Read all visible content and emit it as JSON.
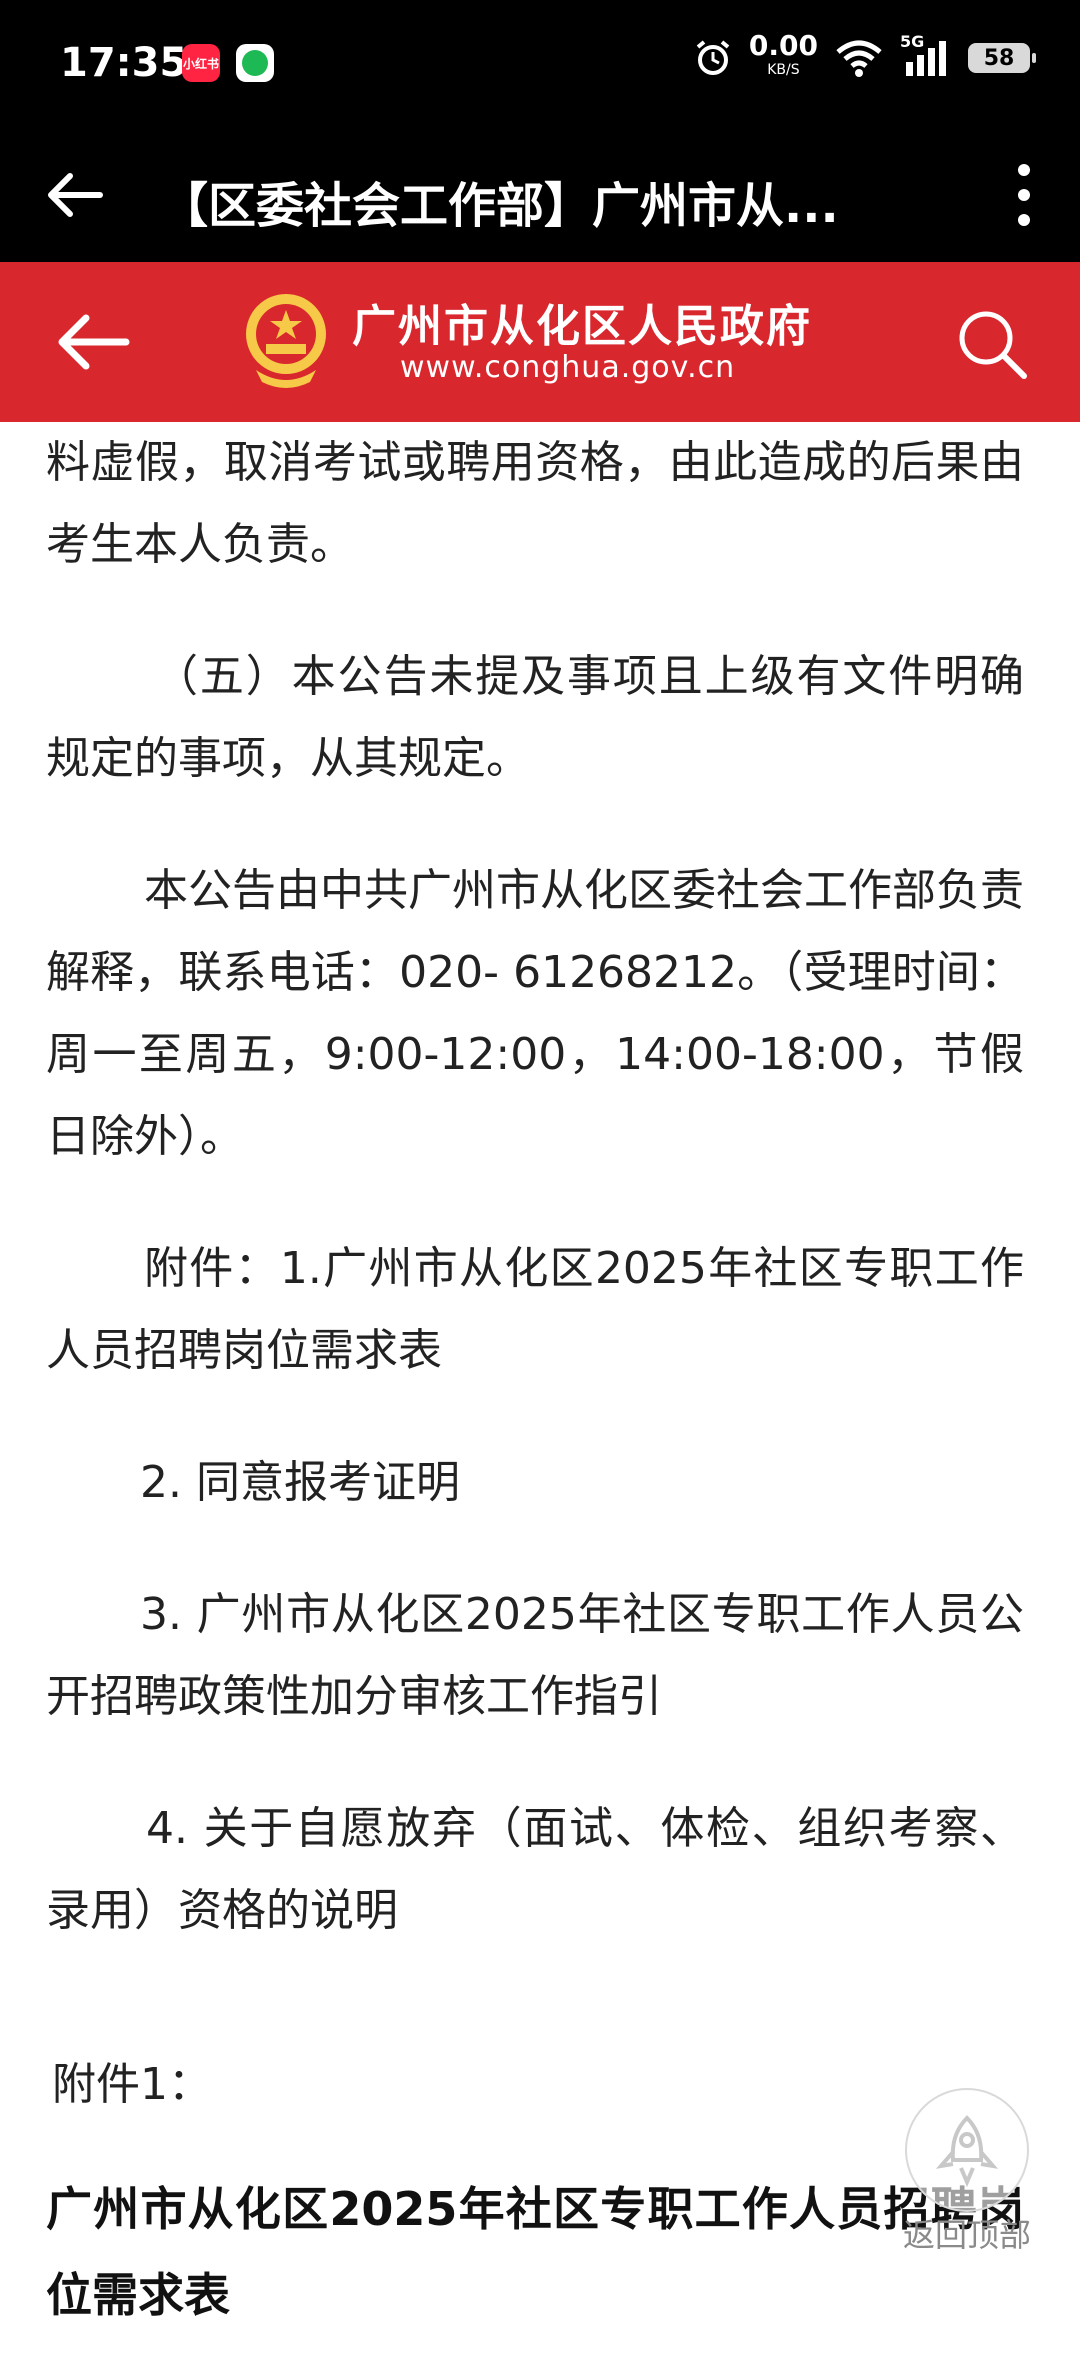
{
  "status": {
    "time": "17:35",
    "app_badge_1": "小红书",
    "net_speed": "0.00",
    "net_unit": "KB/S",
    "network": "5G",
    "battery": "58"
  },
  "titlebar": {
    "title": "【区委社会工作部】广州市从..."
  },
  "header": {
    "site_name": "广州市从化区人民政府",
    "site_url": "www.conghua.gov.cn"
  },
  "article": {
    "p1": "料虚假，取消考试或聘用资格，由此造成的后果由考生本人负责。",
    "p2": "（五）本公告未提及事项且上级有文件明确规定的事项，从其规定。",
    "p3": "本公告由中共广州市从化区委社会工作部负责解释，联系电话：020- 61268212。（受理时间：周一至周五，9:00-12:00，14:00-18:00，节假日除外）。",
    "p4": "附件：1.广州市从化区2025年社区专职工作人员招聘岗位需求表",
    "p5": "2. 同意报考证明",
    "p6": "3. 广州市从化区2025年社区专职工作人员公开招聘政策性加分审核工作指引",
    "p7": "4. 关于自愿放弃（面试、体检、组织考察、录用）资格的说明",
    "attachment_label": "附件1：",
    "table_title": "广州市从化区2025年社区专职工作人员招聘岗位需求表"
  },
  "backtop": {
    "label": "返回顶部"
  }
}
